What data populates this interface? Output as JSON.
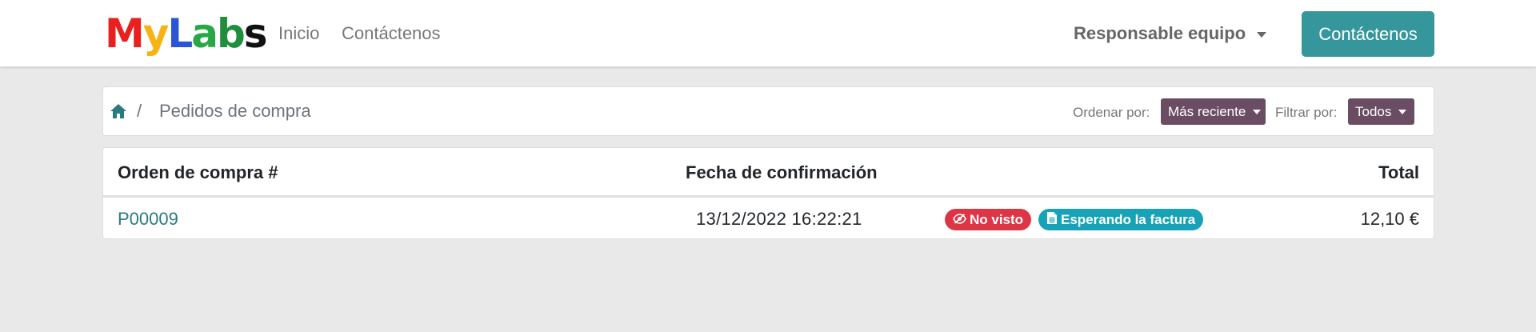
{
  "header": {
    "logo": {
      "letters": [
        {
          "char": "M",
          "color": "#e8211e"
        },
        {
          "char": "y",
          "color": "#f7b313"
        },
        {
          "char": "L",
          "color": "#2a55d6"
        },
        {
          "char": "a",
          "color": "#27a745"
        },
        {
          "char": "b",
          "color": "#1f8e3d"
        },
        {
          "char": "s",
          "color": "#111111"
        }
      ]
    },
    "nav": {
      "home_label": "Inicio",
      "contact_label": "Contáctenos"
    },
    "user_menu_label": "Responsable equipo",
    "cta_label": "Contáctenos",
    "cta_color": "#35979c"
  },
  "breadcrumb": {
    "home_icon": "home-icon",
    "separator": "/",
    "current": "Pedidos de compra"
  },
  "controls": {
    "sort_label": "Ordenar por:",
    "sort_value": "Más reciente",
    "filter_label": "Filtrar por:",
    "filter_value": "Todos",
    "dropdown_color": "#6b4d63"
  },
  "table": {
    "columns": {
      "order": "Orden de compra #",
      "date": "Fecha de confirmación",
      "total": "Total"
    },
    "rows": [
      {
        "order": "P00009",
        "date": "13/12/2022  16:22:21",
        "badges": [
          {
            "icon": "eye-slash-icon",
            "label": "No visto",
            "color": "#dc3545"
          },
          {
            "icon": "document-icon",
            "label": "Esperando la factura",
            "color": "#17a2b8"
          }
        ],
        "total": "12,10 €"
      }
    ]
  }
}
